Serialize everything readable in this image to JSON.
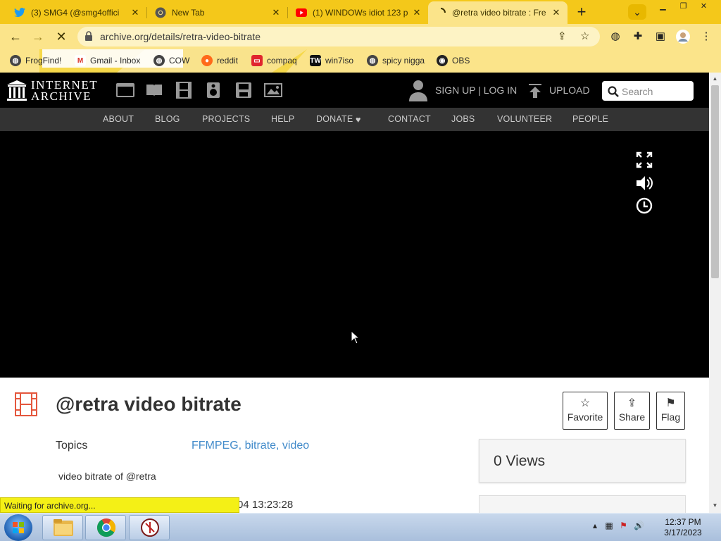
{
  "browser": {
    "tabs": [
      {
        "title": "(3) SMG4 (@smg4offici",
        "icon": "twitter-icon",
        "active": false
      },
      {
        "title": "New Tab",
        "icon": "chrome-icon",
        "active": false
      },
      {
        "title": "(1) WINDOWs idiot 123 p",
        "icon": "youtube-icon",
        "active": false
      },
      {
        "title": "@retra video bitrate : Fre",
        "icon": "loading-icon",
        "active": true
      }
    ],
    "url": "archive.org/details/retra-video-bitrate",
    "bookmarks": [
      {
        "label": "FrogFind!",
        "icon": "globe-icon"
      },
      {
        "label": "Gmail - Inbox",
        "icon": "gmail-icon"
      },
      {
        "label": "COW",
        "icon": "globe-icon"
      },
      {
        "label": "reddit",
        "icon": "reddit-icon"
      },
      {
        "label": "compaq",
        "icon": "compaq-icon"
      },
      {
        "label": "win7iso",
        "icon": "tw-icon"
      },
      {
        "label": "spicy nigga",
        "icon": "globe-icon"
      },
      {
        "label": "OBS",
        "icon": "github-icon"
      }
    ],
    "status_text": "Waiting for archive.org..."
  },
  "site": {
    "logo_line1": "INTERNET",
    "logo_line2": "ARCHIVE",
    "signup": "SIGN UP | LOG IN",
    "upload": "UPLOAD",
    "search_placeholder": "Search",
    "nav": [
      "ABOUT",
      "BLOG",
      "PROJECTS",
      "HELP",
      "DONATE",
      "CONTACT",
      "JOBS",
      "VOLUNTEER",
      "PEOPLE"
    ],
    "donate_heart": "♥"
  },
  "item": {
    "title": "@retra video bitrate",
    "actions": {
      "favorite": "Favorite",
      "share": "Share",
      "flag": "Flag"
    },
    "topics_label": "Topics",
    "topics": [
      "FFMPEG",
      "bitrate",
      "video"
    ],
    "topics_sep": ", ",
    "description": "video bitrate of @retra",
    "date_fragment": "04 13:23:28",
    "views": "0 Views"
  },
  "taskbar": {
    "time": "12:37 PM",
    "date": "3/17/2023"
  },
  "colors": {
    "chrome_bg": "#f4c81a",
    "toolbar_bg": "#fbe48a",
    "ia_black": "#000000",
    "ia_nav": "#333333",
    "link_blue": "#428bca"
  }
}
